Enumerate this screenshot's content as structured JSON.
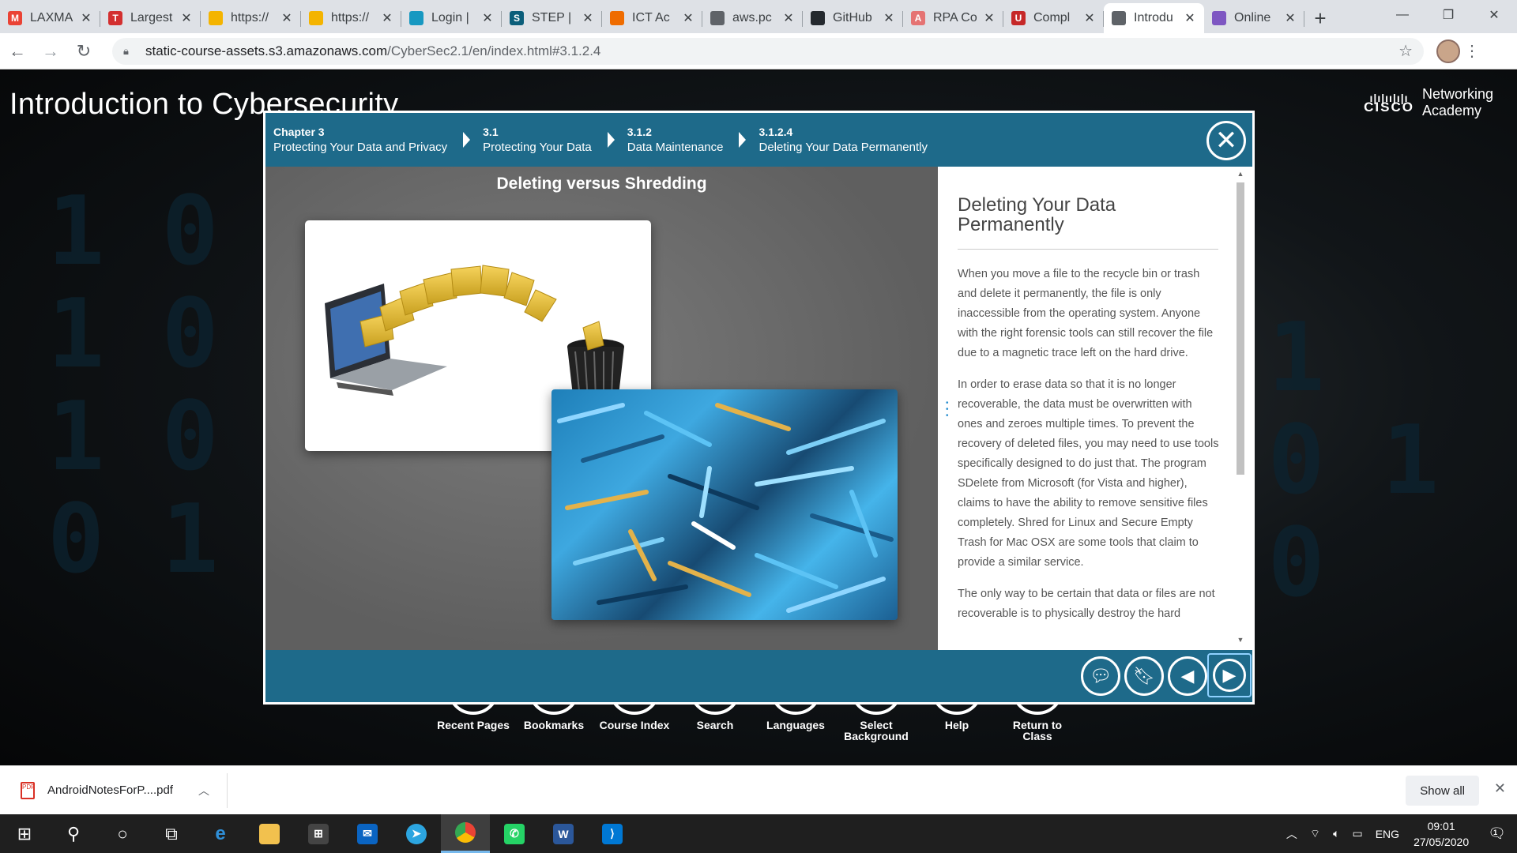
{
  "browser": {
    "tabs": [
      {
        "title": "LAXMA",
        "icon": "gmail-icon",
        "color": "#ea4335",
        "glyph": "M"
      },
      {
        "title": "Largest",
        "icon": "tg-icon",
        "color": "#d32f2f",
        "glyph": "T"
      },
      {
        "title": "https://",
        "icon": "generic-site-icon",
        "color": "#f4b400",
        "glyph": ""
      },
      {
        "title": "https://",
        "icon": "generic-site-icon",
        "color": "#f4b400",
        "glyph": ""
      },
      {
        "title": "Login |",
        "icon": "salesforce-icon",
        "color": "#1798c1",
        "glyph": ""
      },
      {
        "title": "STEP |",
        "icon": "step-icon",
        "color": "#0b5e7a",
        "glyph": "S"
      },
      {
        "title": "ICT Ac",
        "icon": "ict-icon",
        "color": "#ef6c00",
        "glyph": ""
      },
      {
        "title": "aws.pc",
        "icon": "globe-icon",
        "color": "#5f6368",
        "glyph": ""
      },
      {
        "title": "GitHub",
        "icon": "github-icon",
        "color": "#24292e",
        "glyph": ""
      },
      {
        "title": "RPA Co",
        "icon": "rpa-icon",
        "color": "#e57373",
        "glyph": "A"
      },
      {
        "title": "Compl",
        "icon": "udemy-icon",
        "color": "#c62828",
        "glyph": "U"
      },
      {
        "title": "Introdu",
        "icon": "globe-icon",
        "color": "#5f6368",
        "glyph": "",
        "active": true
      },
      {
        "title": "Online",
        "icon": "vs-icon",
        "color": "#7e57c2",
        "glyph": ""
      }
    ],
    "url_host": "static-course-assets.s3.amazonaws.com",
    "url_path": "/CyberSec2.1/en/index.html#3.1.2.4"
  },
  "page": {
    "course_title": "Introduction to Cybersecurity",
    "brand_top": "Networking",
    "brand_bottom": "Academy",
    "brand_word": "CISCO",
    "menu": [
      {
        "label": "Recent Pages",
        "icon": "recent-pages-icon",
        "glyph": "❐"
      },
      {
        "label": "Bookmarks",
        "icon": "bookmark-icon",
        "glyph": "⚑"
      },
      {
        "label": "Course Index",
        "icon": "index-icon",
        "glyph": "☰"
      },
      {
        "label": "Search",
        "icon": "search-icon",
        "glyph": "⚲"
      },
      {
        "label": "Languages",
        "icon": "languages-icon",
        "glyph": "◉"
      },
      {
        "label": "Select Background",
        "icon": "background-icon",
        "glyph": "⋯"
      },
      {
        "label": "Help",
        "icon": "help-icon",
        "glyph": "?"
      },
      {
        "label": "Return to Class",
        "icon": "return-icon",
        "glyph": "⤒"
      }
    ]
  },
  "modal": {
    "breadcrumbs": [
      {
        "num": "Chapter 3",
        "title": "Protecting Your Data and Privacy"
      },
      {
        "num": "3.1",
        "title": "Protecting Your Data"
      },
      {
        "num": "3.1.2",
        "title": "Data Maintenance"
      },
      {
        "num": "3.1.2.4",
        "title": "Deleting Your Data Permanently"
      }
    ],
    "stage_title": "Deleting versus Shredding",
    "heading": "Deleting Your Data Permanently",
    "paragraphs": [
      "When you move a file to the recycle bin or trash and delete it permanently, the file is only inaccessible from the operating system. Anyone with the right forensic tools can still recover the file due to a magnetic trace left on the hard drive.",
      "In order to erase data so that it is no longer recoverable, the data must be overwritten with ones and zeroes multiple times. To prevent the recovery of deleted files, you may need to use tools specifically designed to do just that. The program SDelete from Microsoft (for Vista and higher), claims to have the ability to remove sensitive files completely. Shred for Linux and Secure Empty Trash for Mac OSX are some tools that claim to provide a similar service.",
      "The only way to be certain that data or files are not recoverable is to physically destroy the hard"
    ]
  },
  "downloads": {
    "file": "AndroidNotesForP....pdf",
    "show_all": "Show all"
  },
  "taskbar": {
    "lang": "ENG",
    "time": "09:01",
    "date": "27/05/2020",
    "notif_count": "1"
  }
}
